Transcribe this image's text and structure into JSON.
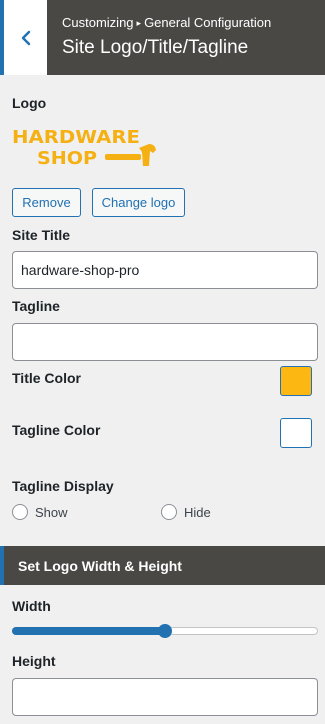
{
  "header": {
    "breadcrumb_root": "Customizing",
    "breadcrumb_separator": "▸",
    "breadcrumb_section": "General Configuration",
    "title": "Site Logo/Title/Tagline"
  },
  "logo": {
    "label": "Logo",
    "line1": "HARDWARE",
    "line2": "SHOP",
    "brand_color": "#f5b014",
    "remove_label": "Remove",
    "change_label": "Change logo"
  },
  "site_title": {
    "label": "Site Title",
    "value": "hardware-shop-pro"
  },
  "tagline": {
    "label": "Tagline",
    "value": ""
  },
  "title_color": {
    "label": "Title Color",
    "value": "#fcb713"
  },
  "tagline_color": {
    "label": "Tagline Color",
    "value": "#ffffff"
  },
  "tagline_display": {
    "label": "Tagline Display",
    "options": [
      "Show",
      "Hide"
    ]
  },
  "logo_size_section": {
    "label": "Set Logo Width & Height"
  },
  "width": {
    "label": "Width",
    "value_fraction": 0.5
  },
  "height": {
    "label": "Height",
    "value": ""
  },
  "colors": {
    "accent": "#2271b1",
    "header_bg": "#4a4845"
  }
}
